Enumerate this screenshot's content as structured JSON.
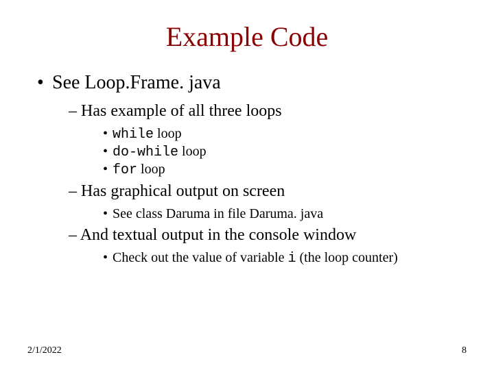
{
  "title": "Example Code",
  "l1_bullet": "•",
  "l3_bullet": "•",
  "dash": "–",
  "main": "See Loop.Frame. java",
  "sub1": "Has example of all three loops",
  "loop1_code": "while",
  "loop1_tail": " loop",
  "loop2_code": "do-while",
  "loop2_tail": " loop",
  "loop3_code": "for",
  "loop3_tail": " loop",
  "sub2": "Has graphical output on screen",
  "sub2_item": "See class Daruma in file Daruma. java",
  "sub3": "And textual output in the console window",
  "sub3_pre": "Check out the value of variable ",
  "sub3_code": "i",
  "sub3_post": " (the loop counter)",
  "date": "2/1/2022",
  "page": "8"
}
